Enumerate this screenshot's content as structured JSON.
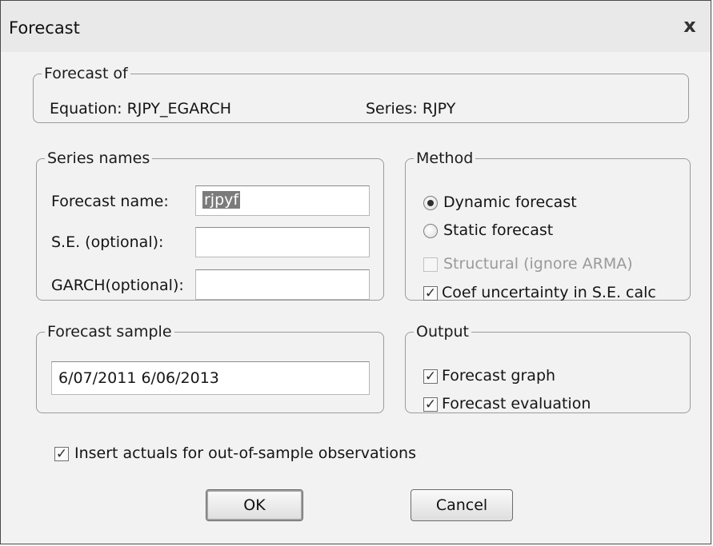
{
  "dialog": {
    "title": "Forecast",
    "close_glyph": "x"
  },
  "forecast_of": {
    "legend": "Forecast of",
    "equation": "Equation: RJPY_EGARCH",
    "series": "Series: RJPY"
  },
  "series_names": {
    "legend": "Series names",
    "forecast_name_label": "Forecast name:",
    "forecast_name_value": "rjpyf",
    "se_label": "S.E. (optional):",
    "se_value": "",
    "garch_label": "GARCH(optional):",
    "garch_value": ""
  },
  "method": {
    "legend": "Method",
    "dynamic_label": "Dynamic forecast",
    "static_label": "Static forecast",
    "selected": "dynamic",
    "structural_label": "Structural (ignore ARMA)",
    "structural_checked": false,
    "structural_enabled": false,
    "coef_label": "Coef uncertainty in S.E. calc",
    "coef_checked": true
  },
  "forecast_sample": {
    "legend": "Forecast sample",
    "value": "6/07/2011 6/06/2013"
  },
  "output": {
    "legend": "Output",
    "graph_label": "Forecast graph",
    "graph_checked": true,
    "evaluation_label": "Forecast evaluation",
    "evaluation_checked": true
  },
  "insert_actuals": {
    "label": "Insert actuals for out-of-sample observations",
    "checked": true
  },
  "buttons": {
    "ok": "OK",
    "cancel": "Cancel"
  },
  "check_glyph": "✓"
}
